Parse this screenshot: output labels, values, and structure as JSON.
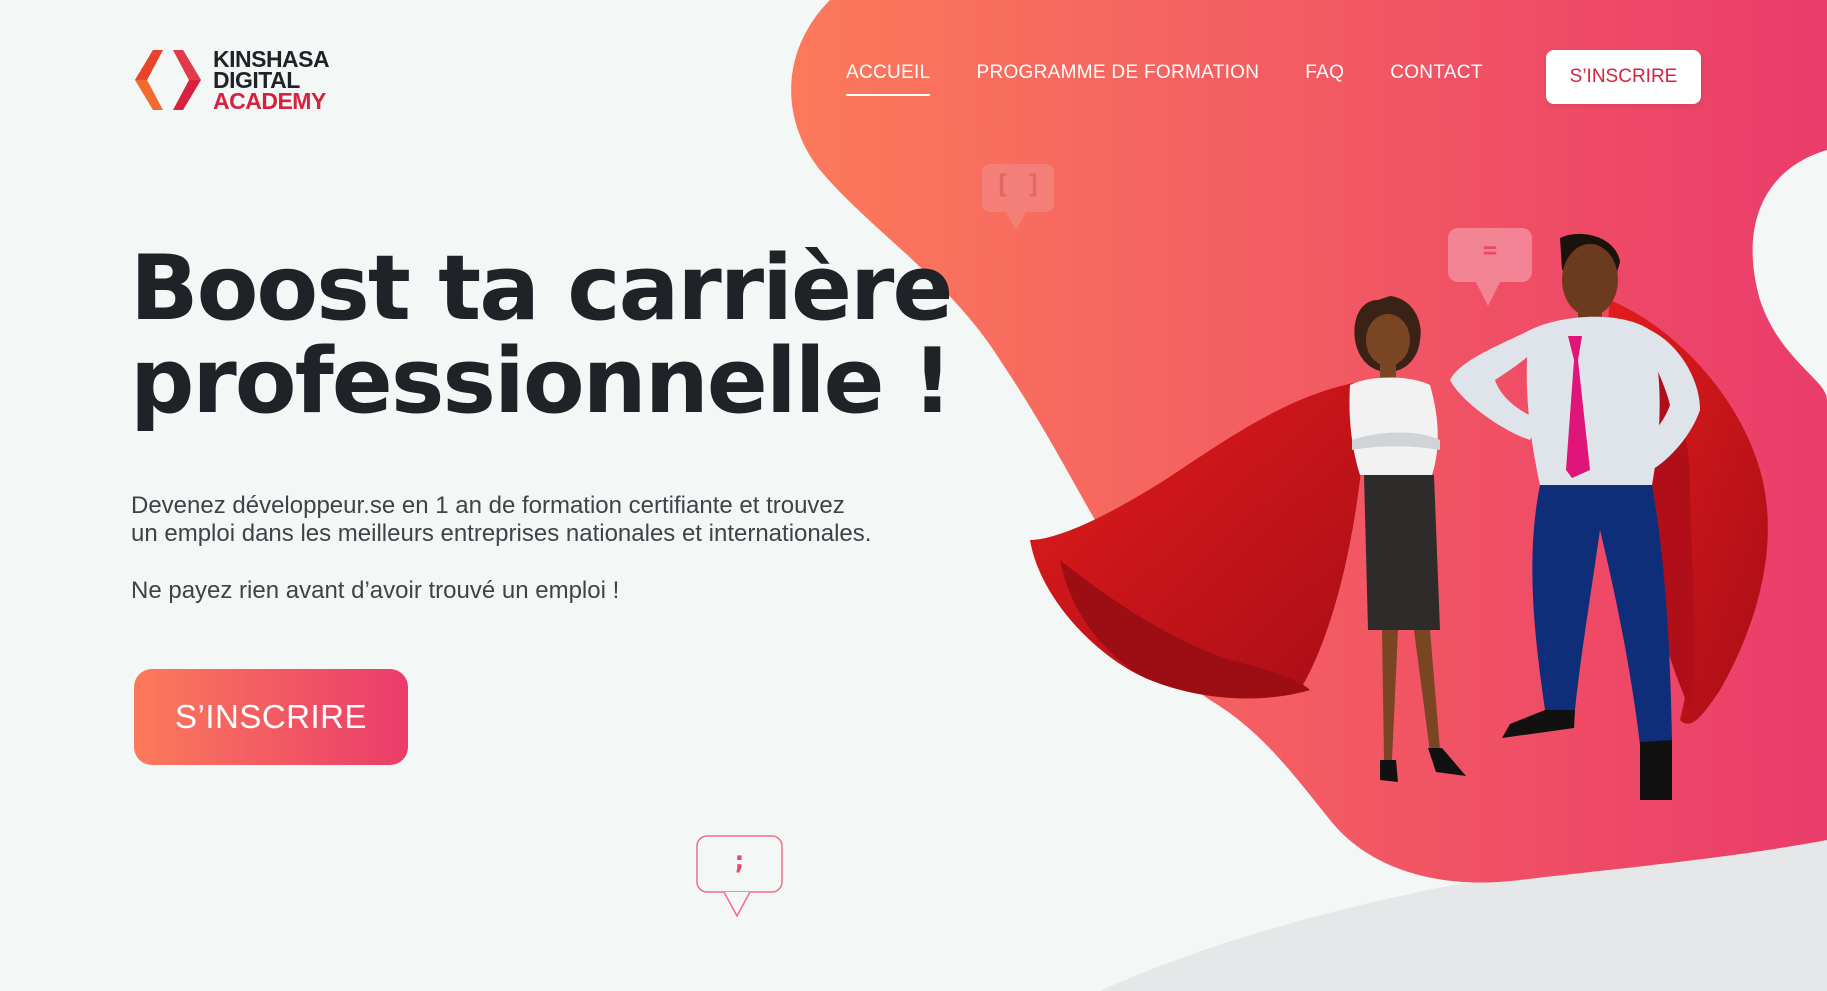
{
  "brand": {
    "lines": [
      "KINSHASA",
      "DIGITAL",
      "ACADEMY"
    ],
    "colors": {
      "dark": "#1f2328",
      "accent": "#d8213f",
      "orange": "#f26a2e"
    }
  },
  "nav": {
    "items": [
      {
        "label": "ACCUEIL",
        "active": true
      },
      {
        "label": "PROGRAMME DE FORMATION",
        "active": false
      },
      {
        "label": "FAQ",
        "active": false
      },
      {
        "label": "CONTACT",
        "active": false
      }
    ],
    "cta_label": "S’INSCRIRE"
  },
  "hero": {
    "title_line1": "Boost ta carrière",
    "title_line2": "professionnelle !",
    "text_line1": "Devenez développeur.se en 1 an de formation certifiante  et trouvez",
    "text_line2": "un emploi dans les meilleurs entreprises nationales  et internationales.",
    "text_line3": "Ne payez rien avant d’avoir trouvé un emploi !",
    "cta_label": "S’INSCRIRE"
  },
  "bubbles": {
    "brackets": "[ ]",
    "equals": "=",
    "semicolon": ";"
  },
  "theme": {
    "gradient_start": "#fc7a5b",
    "gradient_end": "#ea3c6a",
    "background": "#f3f8f6",
    "text_dark": "#1f2328"
  }
}
